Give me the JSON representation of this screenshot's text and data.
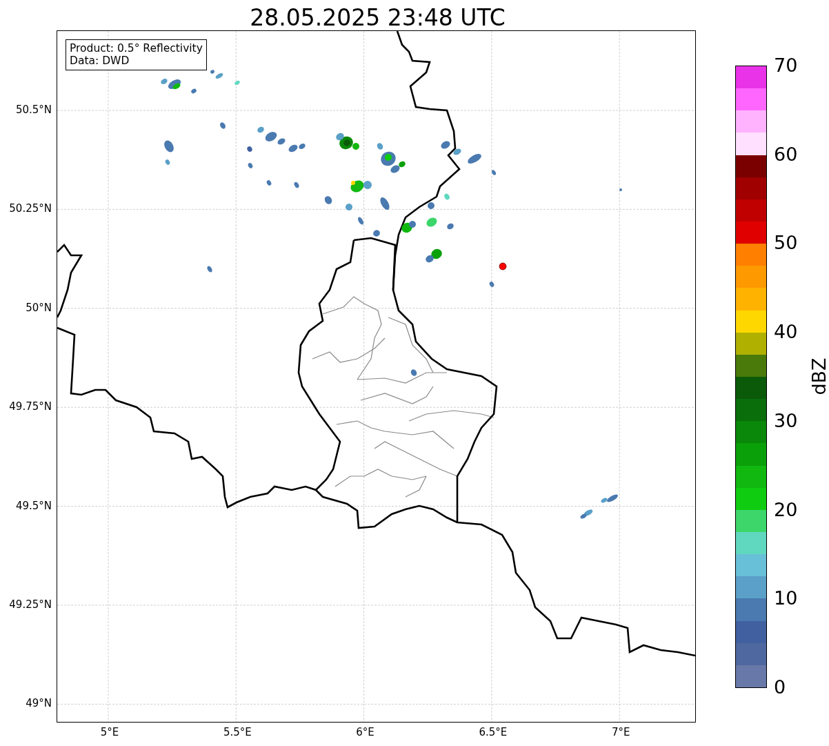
{
  "title": "28.05.2025 23:48 UTC",
  "info_box": {
    "lines": [
      "Product: 0.5° Reflectivity",
      "Data: DWD"
    ]
  },
  "map": {
    "lat_labels": [
      "50.5°N",
      "50.25°N",
      "50°N",
      "49.75°N",
      "49.5°N",
      "49.25°N",
      "49°N"
    ],
    "lon_labels": [
      "5°E",
      "5.5°E",
      "6°E",
      "6.5°E",
      "7°E"
    ]
  },
  "colorbar": {
    "label": "dBZ",
    "ticks": [
      "70",
      "60",
      "50",
      "40",
      "30",
      "20",
      "10",
      "0"
    ],
    "bins": [
      {
        "color": "#e833e8"
      },
      {
        "color": "#ff66ff"
      },
      {
        "color": "#ffb3ff"
      },
      {
        "color": "#ffe0ff"
      },
      {
        "color": "#7a0000"
      },
      {
        "color": "#a00000"
      },
      {
        "color": "#c00000"
      },
      {
        "color": "#e00000"
      },
      {
        "color": "#ff7f00"
      },
      {
        "color": "#ff9900"
      },
      {
        "color": "#ffb300"
      },
      {
        "color": "#ffd700"
      },
      {
        "color": "#b0b000"
      },
      {
        "color": "#4a7a0a"
      },
      {
        "color": "#0a5a0a"
      },
      {
        "color": "#0a6e0a"
      },
      {
        "color": "#0a880a"
      },
      {
        "color": "#0aa00a"
      },
      {
        "color": "#10b810"
      },
      {
        "color": "#10cc10"
      },
      {
        "color": "#3cd66a"
      },
      {
        "color": "#60d8c0"
      },
      {
        "color": "#68c0d8"
      },
      {
        "color": "#5aa0c8"
      },
      {
        "color": "#4a7ab0"
      },
      {
        "color": "#4060a0"
      },
      {
        "color": "#5068a0"
      },
      {
        "color": "#6878a8"
      }
    ]
  }
}
